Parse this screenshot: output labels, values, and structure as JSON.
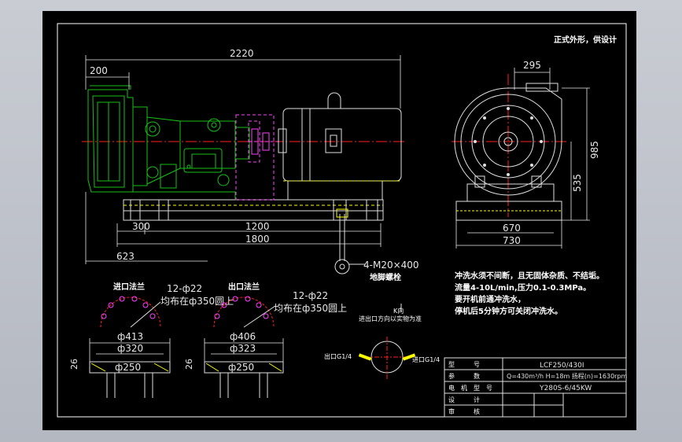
{
  "colors": {
    "background": "#000000",
    "frame": "#ffffff",
    "dimension": "#e8e8e8",
    "centerline": "#ff2020",
    "green": "#18c018",
    "magenta": "#ff40ff",
    "yellow": "#ffff00",
    "notes": "#ffffff"
  },
  "corner_note": "正式外形，供设计",
  "side_view": {
    "dims": {
      "overall_length": "2220",
      "inlet_offset": "200",
      "base_left": "300",
      "base_mid": "1200",
      "base_total": "1800",
      "height_left": "623"
    },
    "bolt_callout": "4-M20×400",
    "bolt_label": "地脚螺栓"
  },
  "end_view": {
    "dims": {
      "outlet_offset": "295",
      "height_total": "985",
      "shaft_height": "535",
      "base_inner": "670",
      "base_outer": "730"
    }
  },
  "notes": [
    "冲洗水须不间断，且无固体杂质、不结垢。",
    "流量4-10L/min,压力0.1-0.3MPa。",
    "要开机前通冲洗水，",
    "停机后5分钟方可关闭冲洗水。"
  ],
  "inlet_flange": {
    "title": "进口法兰",
    "holes": "12-ф22",
    "pcd_note": "均布在ф350圆上",
    "d_outer": "ф413",
    "d_mid": "ф320",
    "d_inner": "ф250",
    "thickness": "26"
  },
  "outlet_flange": {
    "title": "出口法兰",
    "holes": "12-ф22",
    "pcd_note": "均布在ф350圆上",
    "d_outer": "ф406",
    "d_mid": "ф323",
    "d_inner": "ф250",
    "thickness": "26"
  },
  "rotation": {
    "arrow_label": "K向",
    "note": "进出口方向以实物为准",
    "port_left": "出口G1/4",
    "port_right": "进口G1/4"
  },
  "title_block": {
    "rows": [
      {
        "label": "型　　　号",
        "value": "LCF250/430I"
      },
      {
        "label": "参　　　数",
        "value": "Q=430m³/h   H=18m   扬程(n)=1630rpm"
      },
      {
        "label": "电　机　型　号",
        "value": "Y280S-6/45KW"
      },
      {
        "label": "设　　　计",
        "value": ""
      },
      {
        "label": "审　　　核",
        "value": ""
      }
    ]
  }
}
